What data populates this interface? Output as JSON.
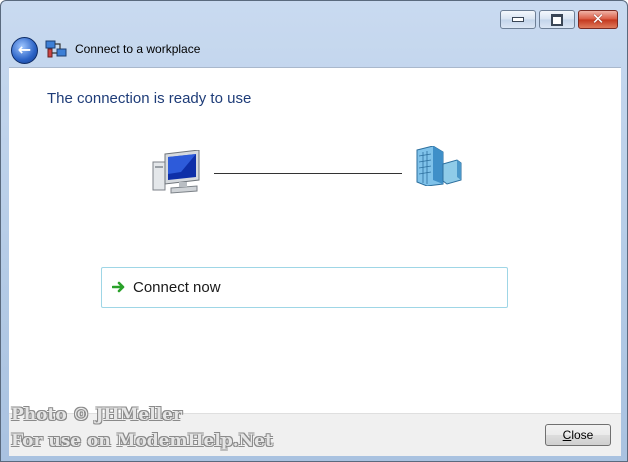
{
  "window": {
    "title": "Connect to a workplace",
    "controls": [
      "minimize-icon",
      "maximize-icon",
      "close-icon"
    ],
    "close_glyph": "✕"
  },
  "nav": {
    "back_icon": "back-arrow-icon",
    "back_glyph": "←"
  },
  "main": {
    "heading": "The connection is ready to use",
    "left_icon": "computer-icon",
    "right_icon": "workplace-server-icon",
    "option": {
      "icon": "green-arrow-icon",
      "label": "Connect now"
    }
  },
  "footer": {
    "close_label_access": "C",
    "close_label_rest": "lose"
  },
  "watermark": {
    "line1": "Photo © JHMeller",
    "line2": "For use on ModemHelp.Net"
  },
  "colors": {
    "heading": "#1e3c78",
    "accent_border": "#9fd6e6",
    "arrow": "#2aa12a"
  }
}
